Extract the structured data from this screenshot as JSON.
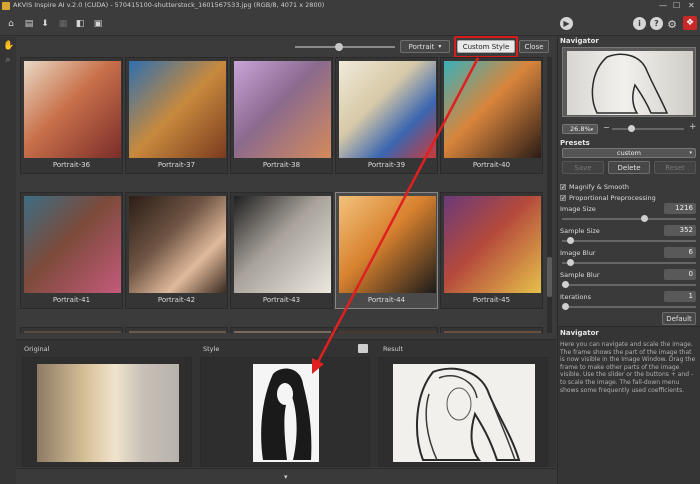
{
  "window": {
    "title": "AKVIS Inspire AI v.2.0 (CUDA) - 570415100-shutterstock_1601567533.jpg (RGB/8, 4071 x 2800)",
    "controls": [
      "—",
      "☐",
      "✕"
    ]
  },
  "toolbar": {
    "icons": [
      "home-icon",
      "open-file-icon",
      "save-icon",
      "print-icon",
      "before-after-icon",
      "share-icon"
    ],
    "right_icons": [
      "play-icon",
      "info-icon",
      "help-icon",
      "settings-icon",
      "plugin-icon"
    ]
  },
  "gallery": {
    "dropdown_value": "Portrait",
    "custom_style_label": "Custom Style",
    "close_label": "Close",
    "tiles": [
      {
        "label": "Portrait-36",
        "color": "#c9704a"
      },
      {
        "label": "Portrait-37",
        "color": "#c88a3d"
      },
      {
        "label": "Portrait-38",
        "color": "#8a6a8e"
      },
      {
        "label": "Portrait-39",
        "color": "#d7c9a8"
      },
      {
        "label": "Portrait-40",
        "color": "#d9853c"
      },
      {
        "label": "Portrait-41",
        "color": "#7c4a3a"
      },
      {
        "label": "Portrait-42",
        "color": "#6e5443"
      },
      {
        "label": "Portrait-43",
        "color": "#a8a29a"
      },
      {
        "label": "Portrait-44",
        "color": "#d8812e"
      },
      {
        "label": "Portrait-45",
        "color": "#b54a3c"
      }
    ],
    "selected": "Portrait-44"
  },
  "bottom": {
    "original_label": "Original",
    "style_label": "Style",
    "result_label": "Result"
  },
  "navigator": {
    "title": "Navigator",
    "zoom": "26.8%"
  },
  "presets": {
    "title": "Presets",
    "value": "custom",
    "save_label": "Save",
    "delete_label": "Delete",
    "reset_label": "Reset"
  },
  "settings": {
    "magnify_smooth": "Magnify & Smooth",
    "proportional": "Proportional Preprocessing",
    "image_size_label": "Image Size",
    "image_size": "1216",
    "image_size_level": 0.62,
    "sample_size_label": "Sample Size",
    "sample_size": "352",
    "sample_size_level": 0.04,
    "image_blur_label": "Image Blur",
    "image_blur": "6",
    "image_blur_level": 0.04,
    "sample_blur_label": "Sample Blur",
    "sample_blur": "0",
    "sample_blur_level": 0.0,
    "iterations_label": "Iterations",
    "iterations": "1",
    "iterations_level": 0.0,
    "default_label": "Default"
  },
  "help": {
    "title": "Navigator",
    "text": "Here you can navigate and scale the image. The frame shows the part of the image that is now visible in the Image Window. Drag the frame to make other parts of the image visible. Use the slider or the buttons + and - to scale the image. The fall-down menu shows some frequently used coefficients."
  },
  "colors": {
    "accent_red": "#d81c1c",
    "panel": "#3a3a3a"
  }
}
